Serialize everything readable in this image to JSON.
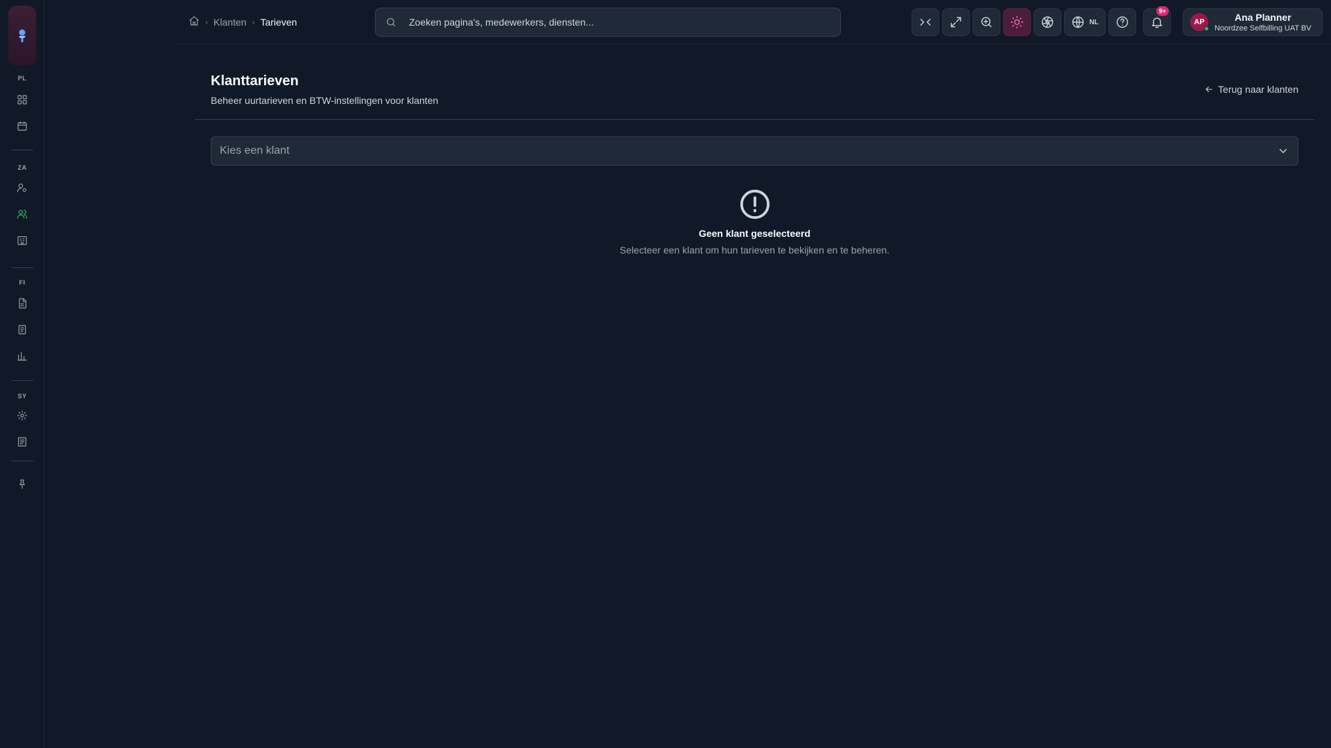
{
  "rail": {
    "sections": [
      "PL",
      "ZA",
      "FI",
      "SY"
    ]
  },
  "breadcrumb": {
    "items": [
      "Klanten"
    ],
    "current": "Tarieven"
  },
  "search": {
    "placeholder": "Zoeken pagina's, medewerkers, diensten..."
  },
  "toolbar": {
    "language_code": "NL",
    "notification_badge": "9+"
  },
  "user": {
    "initials": "AP",
    "name": "Ana Planner",
    "org": "Noordzee Selfbilling UAT BV"
  },
  "page": {
    "title": "Klanttarieven",
    "subtitle": "Beheer uurtarieven en BTW-instellingen voor klanten",
    "back_link": "Terug naar klanten"
  },
  "client_select": {
    "placeholder": "Kies een klant"
  },
  "empty_state": {
    "title": "Geen klant geselecteerd",
    "message": "Selecteer een klant om hun tarieven te bekijken en te beheren."
  },
  "colors": {
    "background": "#111827",
    "surface": "#1f2937",
    "accent_pink": "#db2777",
    "active_green": "#22c55e"
  }
}
